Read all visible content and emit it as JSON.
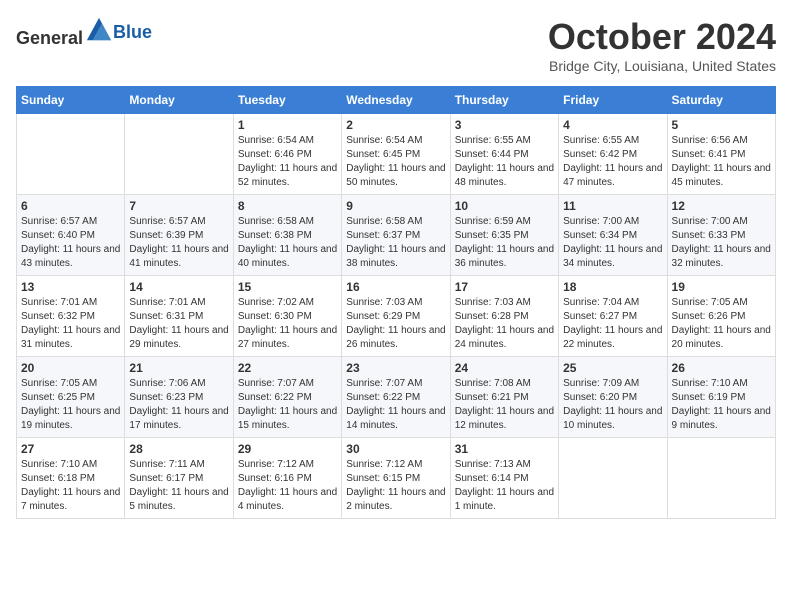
{
  "logo": {
    "general": "General",
    "blue": "Blue"
  },
  "header": {
    "month_title": "October 2024",
    "location": "Bridge City, Louisiana, United States"
  },
  "days_of_week": [
    "Sunday",
    "Monday",
    "Tuesday",
    "Wednesday",
    "Thursday",
    "Friday",
    "Saturday"
  ],
  "weeks": [
    [
      {
        "day": "",
        "info": ""
      },
      {
        "day": "",
        "info": ""
      },
      {
        "day": "1",
        "info": "Sunrise: 6:54 AM\nSunset: 6:46 PM\nDaylight: 11 hours and 52 minutes."
      },
      {
        "day": "2",
        "info": "Sunrise: 6:54 AM\nSunset: 6:45 PM\nDaylight: 11 hours and 50 minutes."
      },
      {
        "day": "3",
        "info": "Sunrise: 6:55 AM\nSunset: 6:44 PM\nDaylight: 11 hours and 48 minutes."
      },
      {
        "day": "4",
        "info": "Sunrise: 6:55 AM\nSunset: 6:42 PM\nDaylight: 11 hours and 47 minutes."
      },
      {
        "day": "5",
        "info": "Sunrise: 6:56 AM\nSunset: 6:41 PM\nDaylight: 11 hours and 45 minutes."
      }
    ],
    [
      {
        "day": "6",
        "info": "Sunrise: 6:57 AM\nSunset: 6:40 PM\nDaylight: 11 hours and 43 minutes."
      },
      {
        "day": "7",
        "info": "Sunrise: 6:57 AM\nSunset: 6:39 PM\nDaylight: 11 hours and 41 minutes."
      },
      {
        "day": "8",
        "info": "Sunrise: 6:58 AM\nSunset: 6:38 PM\nDaylight: 11 hours and 40 minutes."
      },
      {
        "day": "9",
        "info": "Sunrise: 6:58 AM\nSunset: 6:37 PM\nDaylight: 11 hours and 38 minutes."
      },
      {
        "day": "10",
        "info": "Sunrise: 6:59 AM\nSunset: 6:35 PM\nDaylight: 11 hours and 36 minutes."
      },
      {
        "day": "11",
        "info": "Sunrise: 7:00 AM\nSunset: 6:34 PM\nDaylight: 11 hours and 34 minutes."
      },
      {
        "day": "12",
        "info": "Sunrise: 7:00 AM\nSunset: 6:33 PM\nDaylight: 11 hours and 32 minutes."
      }
    ],
    [
      {
        "day": "13",
        "info": "Sunrise: 7:01 AM\nSunset: 6:32 PM\nDaylight: 11 hours and 31 minutes."
      },
      {
        "day": "14",
        "info": "Sunrise: 7:01 AM\nSunset: 6:31 PM\nDaylight: 11 hours and 29 minutes."
      },
      {
        "day": "15",
        "info": "Sunrise: 7:02 AM\nSunset: 6:30 PM\nDaylight: 11 hours and 27 minutes."
      },
      {
        "day": "16",
        "info": "Sunrise: 7:03 AM\nSunset: 6:29 PM\nDaylight: 11 hours and 26 minutes."
      },
      {
        "day": "17",
        "info": "Sunrise: 7:03 AM\nSunset: 6:28 PM\nDaylight: 11 hours and 24 minutes."
      },
      {
        "day": "18",
        "info": "Sunrise: 7:04 AM\nSunset: 6:27 PM\nDaylight: 11 hours and 22 minutes."
      },
      {
        "day": "19",
        "info": "Sunrise: 7:05 AM\nSunset: 6:26 PM\nDaylight: 11 hours and 20 minutes."
      }
    ],
    [
      {
        "day": "20",
        "info": "Sunrise: 7:05 AM\nSunset: 6:25 PM\nDaylight: 11 hours and 19 minutes."
      },
      {
        "day": "21",
        "info": "Sunrise: 7:06 AM\nSunset: 6:23 PM\nDaylight: 11 hours and 17 minutes."
      },
      {
        "day": "22",
        "info": "Sunrise: 7:07 AM\nSunset: 6:22 PM\nDaylight: 11 hours and 15 minutes."
      },
      {
        "day": "23",
        "info": "Sunrise: 7:07 AM\nSunset: 6:22 PM\nDaylight: 11 hours and 14 minutes."
      },
      {
        "day": "24",
        "info": "Sunrise: 7:08 AM\nSunset: 6:21 PM\nDaylight: 11 hours and 12 minutes."
      },
      {
        "day": "25",
        "info": "Sunrise: 7:09 AM\nSunset: 6:20 PM\nDaylight: 11 hours and 10 minutes."
      },
      {
        "day": "26",
        "info": "Sunrise: 7:10 AM\nSunset: 6:19 PM\nDaylight: 11 hours and 9 minutes."
      }
    ],
    [
      {
        "day": "27",
        "info": "Sunrise: 7:10 AM\nSunset: 6:18 PM\nDaylight: 11 hours and 7 minutes."
      },
      {
        "day": "28",
        "info": "Sunrise: 7:11 AM\nSunset: 6:17 PM\nDaylight: 11 hours and 5 minutes."
      },
      {
        "day": "29",
        "info": "Sunrise: 7:12 AM\nSunset: 6:16 PM\nDaylight: 11 hours and 4 minutes."
      },
      {
        "day": "30",
        "info": "Sunrise: 7:12 AM\nSunset: 6:15 PM\nDaylight: 11 hours and 2 minutes."
      },
      {
        "day": "31",
        "info": "Sunrise: 7:13 AM\nSunset: 6:14 PM\nDaylight: 11 hours and 1 minute."
      },
      {
        "day": "",
        "info": ""
      },
      {
        "day": "",
        "info": ""
      }
    ]
  ]
}
